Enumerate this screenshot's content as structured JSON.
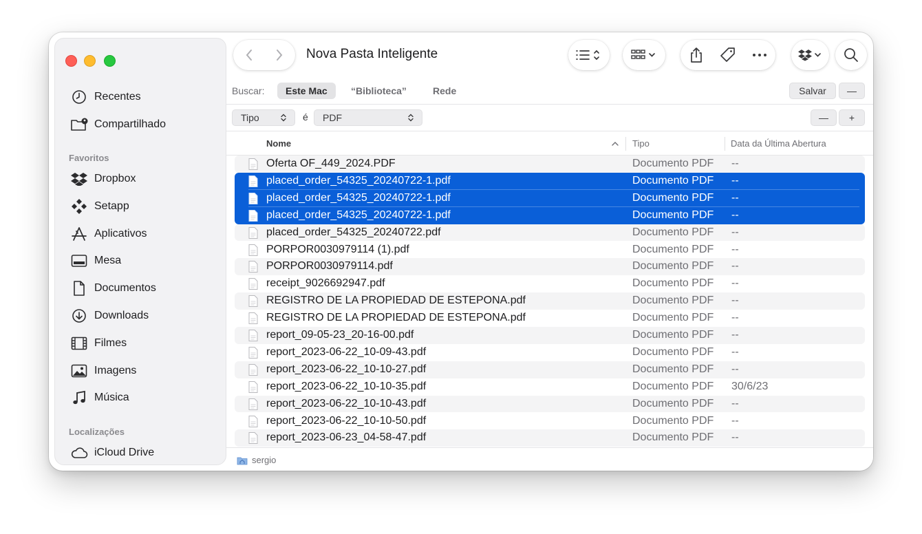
{
  "window": {
    "title": "Nova Pasta Inteligente"
  },
  "sidebar": {
    "top_items": [
      {
        "label": "Recentes",
        "icon": "clock-icon"
      },
      {
        "label": "Compartilhado",
        "icon": "shared-folder-icon"
      }
    ],
    "favorites_label": "Favoritos",
    "favorites": [
      {
        "label": "Dropbox",
        "icon": "dropbox-icon"
      },
      {
        "label": "Setapp",
        "icon": "setapp-icon"
      },
      {
        "label": "Aplicativos",
        "icon": "applications-icon"
      },
      {
        "label": "Mesa",
        "icon": "desktop-icon"
      },
      {
        "label": "Documentos",
        "icon": "document-icon"
      },
      {
        "label": "Downloads",
        "icon": "download-icon"
      },
      {
        "label": "Filmes",
        "icon": "film-icon"
      },
      {
        "label": "Imagens",
        "icon": "photo-icon"
      },
      {
        "label": "Música",
        "icon": "music-icon"
      }
    ],
    "locations_label": "Localizações",
    "locations": [
      {
        "label": "iCloud Drive",
        "icon": "cloud-icon"
      }
    ]
  },
  "search": {
    "label": "Buscar:",
    "scopes": [
      "Este Mac",
      "“Biblioteca”",
      "Rede"
    ],
    "active_scope": "Este Mac",
    "save_label": "Salvar",
    "remove_label": "—"
  },
  "criteria": {
    "attribute": "Tipo",
    "operator": "é",
    "value": "PDF",
    "remove_label": "—",
    "add_label": "+"
  },
  "columns": {
    "name": "Nome",
    "type": "Tipo",
    "date": "Data da Última Abertura"
  },
  "files": [
    {
      "name": "Oferta OF_449_2024.PDF",
      "type": "Documento PDF",
      "date": "--",
      "selected": false
    },
    {
      "name": "placed_order_54325_20240722-1.pdf",
      "type": "Documento PDF",
      "date": "--",
      "selected": true
    },
    {
      "name": "placed_order_54325_20240722-1.pdf",
      "type": "Documento PDF",
      "date": "--",
      "selected": true
    },
    {
      "name": "placed_order_54325_20240722-1.pdf",
      "type": "Documento PDF",
      "date": "--",
      "selected": true
    },
    {
      "name": "placed_order_54325_20240722.pdf",
      "type": "Documento PDF",
      "date": "--",
      "selected": false
    },
    {
      "name": "PORPOR0030979114 (1).pdf",
      "type": "Documento PDF",
      "date": "--",
      "selected": false
    },
    {
      "name": "PORPOR0030979114.pdf",
      "type": "Documento PDF",
      "date": "--",
      "selected": false
    },
    {
      "name": "receipt_9026692947.pdf",
      "type": "Documento PDF",
      "date": "--",
      "selected": false
    },
    {
      "name": "REGISTRO DE LA PROPIEDAD DE ESTEPONA.pdf",
      "type": "Documento PDF",
      "date": "--",
      "selected": false
    },
    {
      "name": "REGISTRO DE LA PROPIEDAD DE ESTEPONA.pdf",
      "type": "Documento PDF",
      "date": "--",
      "selected": false
    },
    {
      "name": "report_09-05-23_20-16-00.pdf",
      "type": "Documento PDF",
      "date": "--",
      "selected": false
    },
    {
      "name": "report_2023-06-22_10-09-43.pdf",
      "type": "Documento PDF",
      "date": "--",
      "selected": false
    },
    {
      "name": "report_2023-06-22_10-10-27.pdf",
      "type": "Documento PDF",
      "date": "--",
      "selected": false
    },
    {
      "name": "report_2023-06-22_10-10-35.pdf",
      "type": "Documento PDF",
      "date": "30/6/23",
      "selected": false
    },
    {
      "name": "report_2023-06-22_10-10-43.pdf",
      "type": "Documento PDF",
      "date": "--",
      "selected": false
    },
    {
      "name": "report_2023-06-22_10-10-50.pdf",
      "type": "Documento PDF",
      "date": "--",
      "selected": false
    },
    {
      "name": "report_2023-06-23_04-58-47.pdf",
      "type": "Documento PDF",
      "date": "--",
      "selected": false
    }
  ],
  "pathbar": {
    "path": "sergio"
  },
  "colors": {
    "selection": "#0a5fd8",
    "close": "#fe5f57",
    "minimize": "#febc2e",
    "zoom": "#28c840"
  }
}
